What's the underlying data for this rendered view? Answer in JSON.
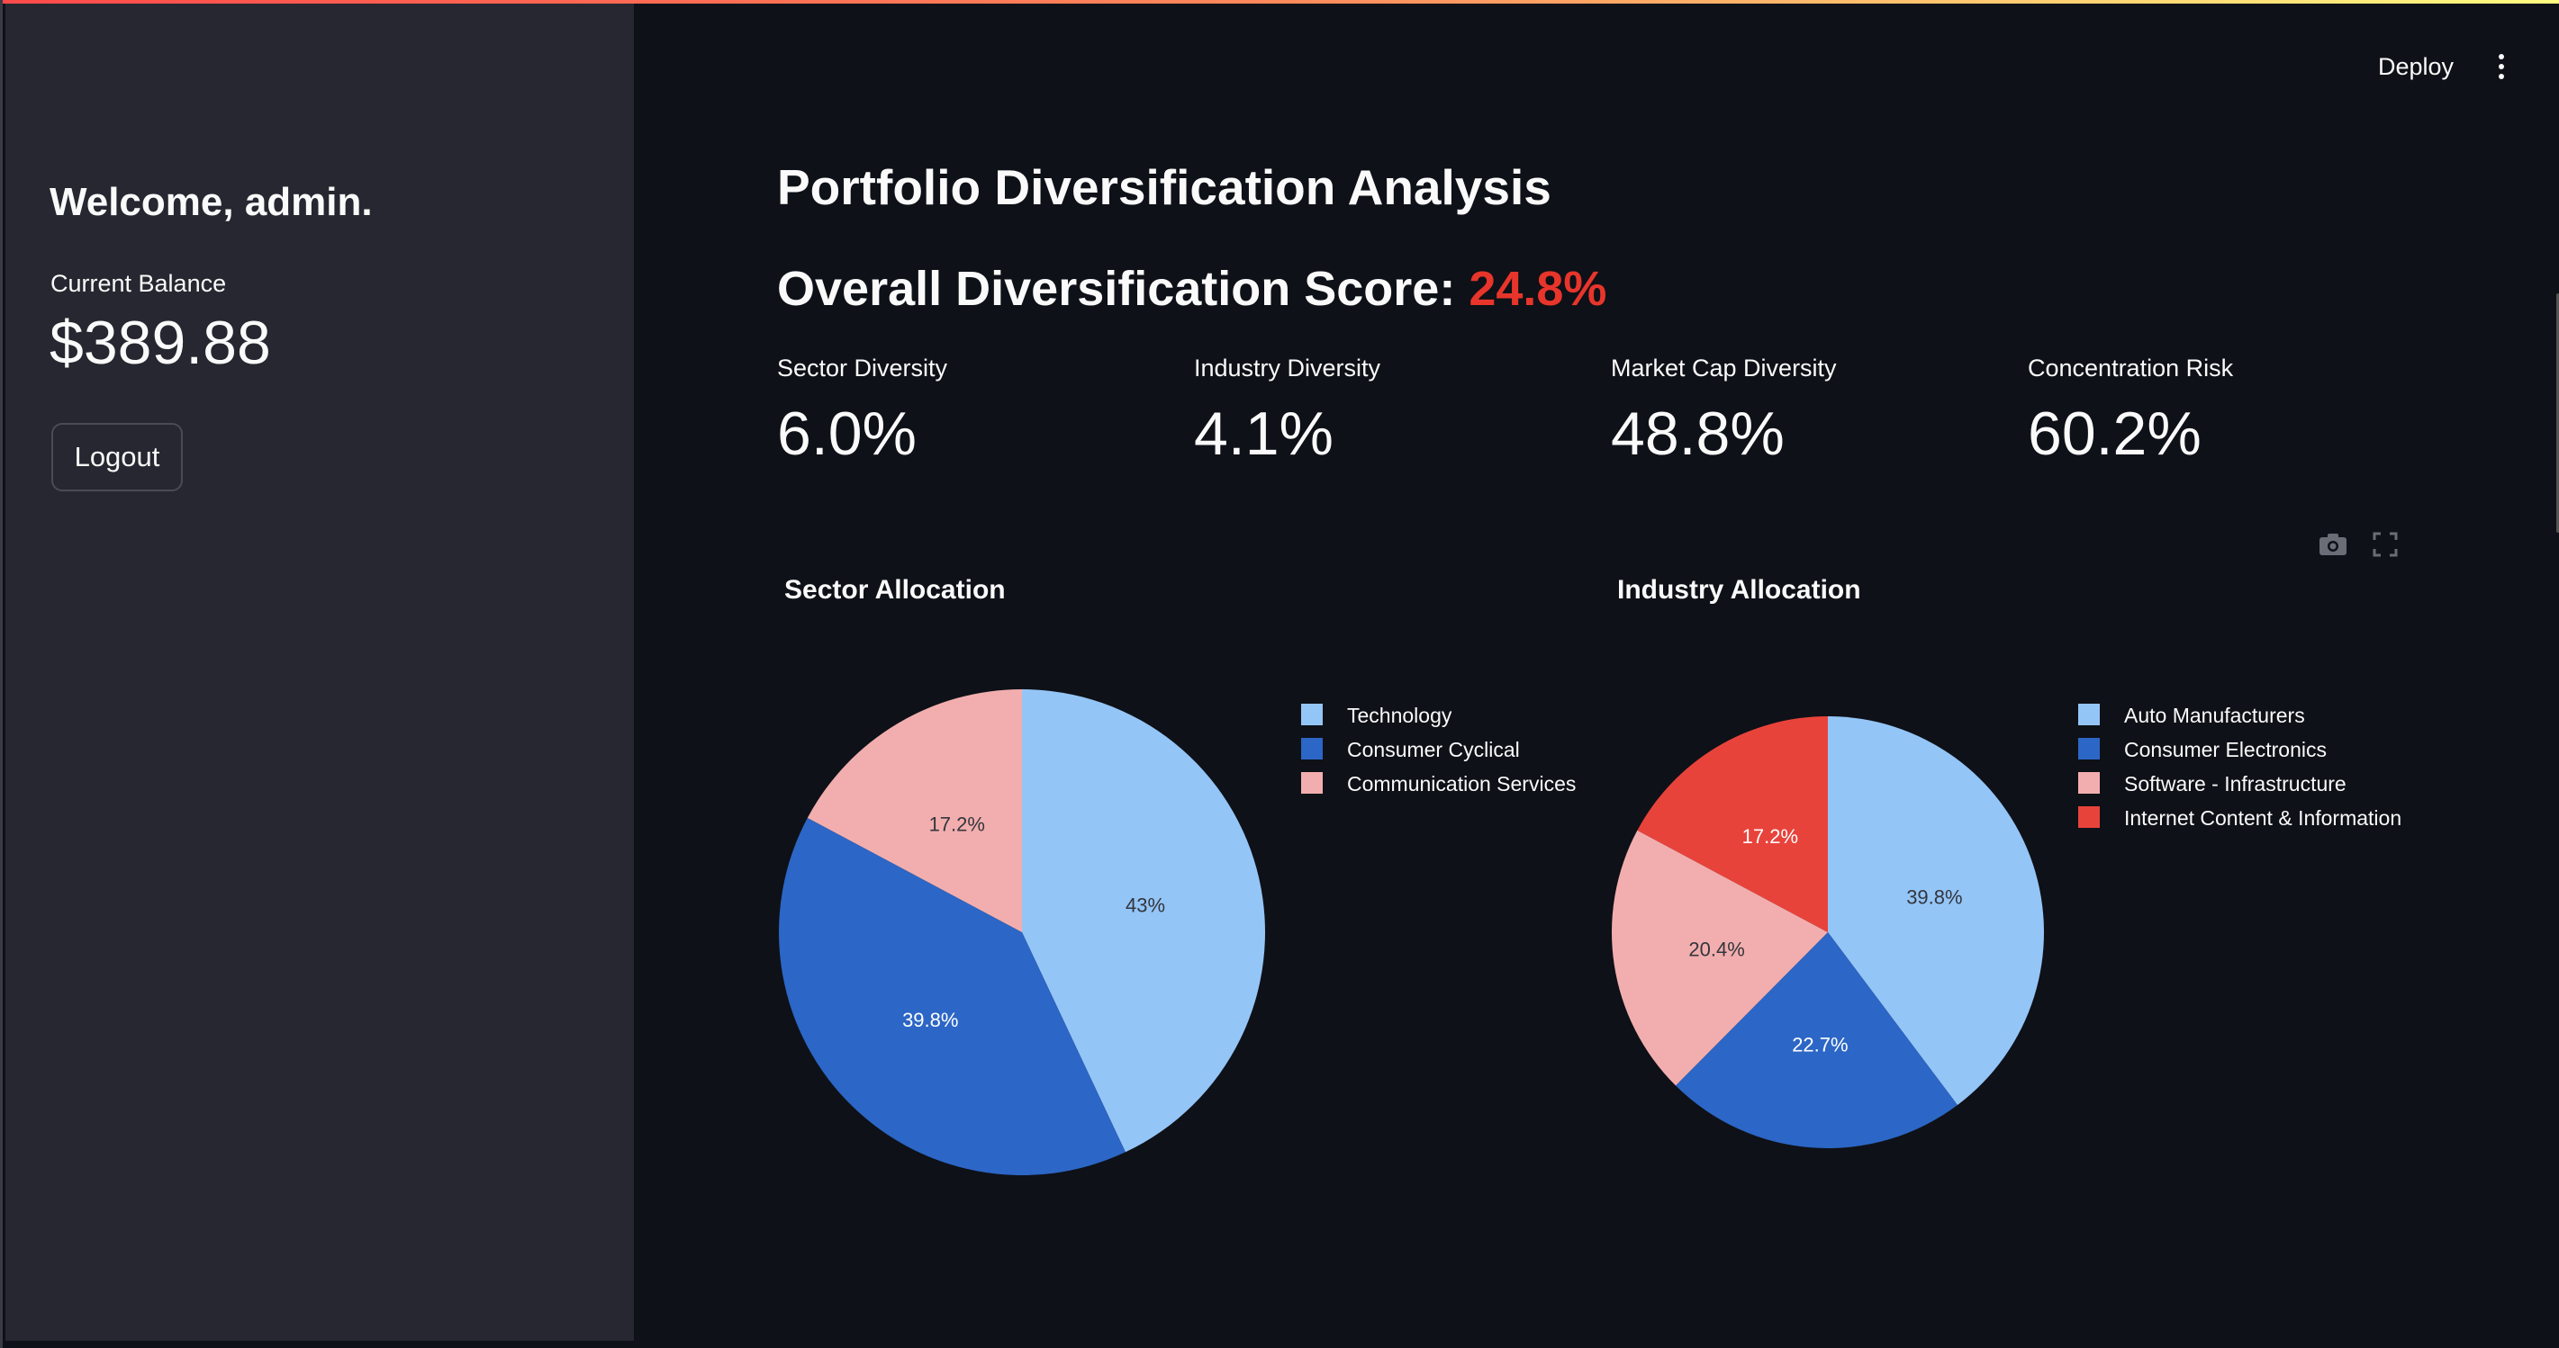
{
  "header": {
    "deploy_label": "Deploy",
    "menu_icon": "kebab-menu-icon"
  },
  "sidebar": {
    "welcome": "Welcome, admin.",
    "balance_label": "Current Balance",
    "balance_value": "$389.88",
    "logout_label": "Logout"
  },
  "main": {
    "title": "Portfolio Diversification Analysis",
    "score_label": "Overall Diversification Score: ",
    "score_value": "24.8%",
    "score_color": "#e8352b",
    "metrics": [
      {
        "label": "Sector Diversity",
        "value": "6.0%"
      },
      {
        "label": "Industry Diversity",
        "value": "4.1%"
      },
      {
        "label": "Market Cap Diversity",
        "value": "48.8%"
      },
      {
        "label": "Concentration Risk",
        "value": "60.2%"
      }
    ],
    "chart_tools": [
      "camera-icon",
      "fullscreen-icon"
    ]
  },
  "chart_data": [
    {
      "type": "pie",
      "title": "Sector Allocation",
      "categories": [
        "Technology",
        "Consumer Cyclical",
        "Communication Services"
      ],
      "values": [
        43.0,
        39.8,
        17.2
      ],
      "labels": [
        "43%",
        "39.8%",
        "17.2%"
      ],
      "colors": [
        "#94c5f7",
        "#2c66c6",
        "#f2aeae"
      ],
      "legend": "right"
    },
    {
      "type": "pie",
      "title": "Industry Allocation",
      "categories": [
        "Auto Manufacturers",
        "Consumer Electronics",
        "Software - Infrastructure",
        "Internet Content & Information"
      ],
      "values": [
        39.8,
        22.7,
        20.4,
        17.2
      ],
      "labels": [
        "39.8%",
        "22.7%",
        "20.4%",
        "17.2%"
      ],
      "colors": [
        "#94c5f7",
        "#2c66c6",
        "#f2aeae",
        "#e8433b"
      ],
      "legend": "right"
    }
  ]
}
